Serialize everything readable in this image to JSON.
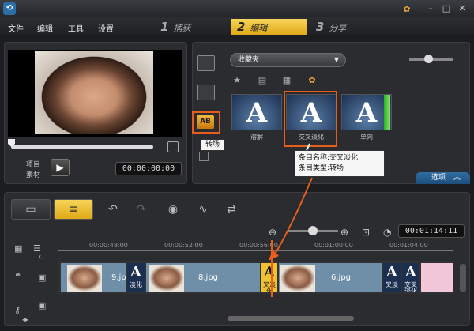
{
  "menubar": {
    "items": [
      "文件",
      "编辑",
      "工具",
      "设置"
    ]
  },
  "steps": [
    {
      "num": "1",
      "label": "捕获"
    },
    {
      "num": "2",
      "label": "编辑"
    },
    {
      "num": "3",
      "label": "分享"
    }
  ],
  "preview": {
    "project_label": "项目",
    "clip_label": "素材",
    "timecode": "00:00:00:00"
  },
  "library": {
    "folder": "收藏夹",
    "transition_tooltip": "转场",
    "thumbnails": [
      {
        "letter": "A",
        "label": "溶解"
      },
      {
        "letter": "A",
        "label": "交叉淡化"
      },
      {
        "letter": "A",
        "label": "单向"
      }
    ],
    "info_tip": {
      "line1": "条目名称:交叉淡化",
      "line2": "条目类型:转场"
    },
    "options_label": "选项"
  },
  "timeline": {
    "timecode": "00:01:14:11",
    "ruler_ticks": [
      "00:00:48:00",
      "00:00:52:00",
      "00:00:56:00",
      "00:01:00:00",
      "00:01:04:00"
    ],
    "clips": [
      {
        "name": "9.jpg"
      },
      {
        "name": "8.jpg"
      },
      {
        "name": "6.jpg"
      }
    ],
    "transitions": [
      {
        "letter": "A",
        "sub": "淡化"
      },
      {
        "letter": "A",
        "sub": "叉淡化"
      },
      {
        "letter": "A",
        "sub": "叉淡"
      },
      {
        "letter": "A",
        "sub": "交叉淡化"
      }
    ]
  },
  "colors": {
    "accent_orange": "#e85d1c",
    "tab_gold": "#e0a817",
    "options_blue": "#1c4d7c"
  }
}
